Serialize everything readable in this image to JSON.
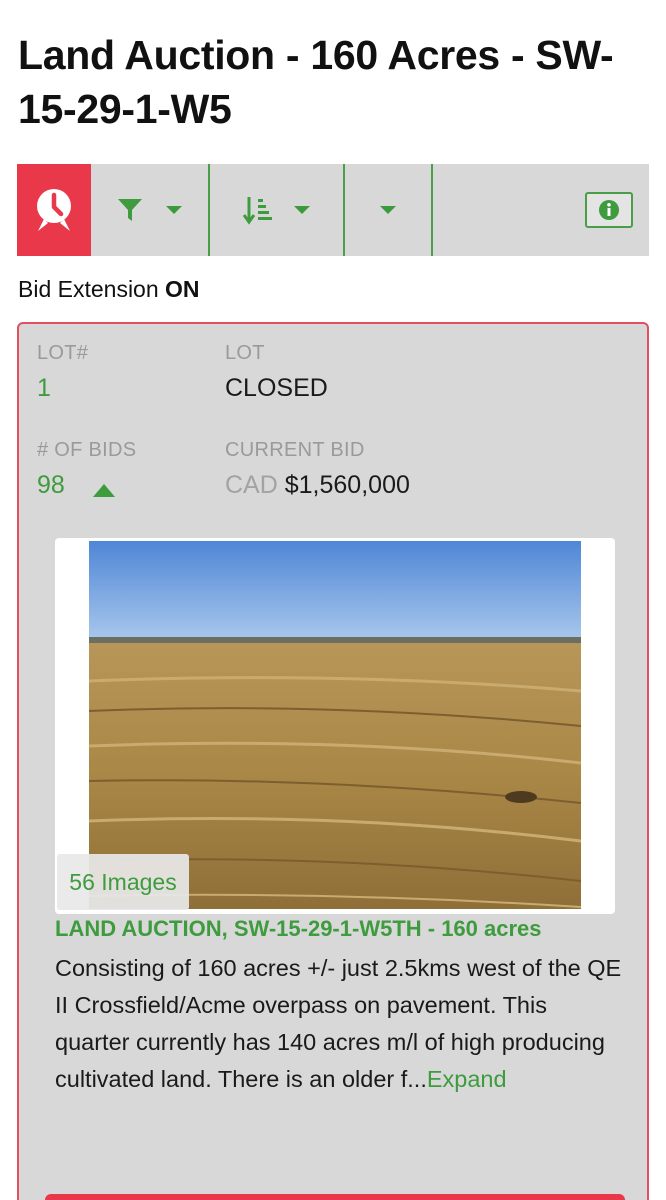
{
  "page": {
    "title": "Land Auction - 160 Acres - SW-15-29-1-W5"
  },
  "toolbar": {
    "icons": {
      "clock": "clock-icon",
      "filter": "filter-icon",
      "sort": "sort-icon",
      "info": "info-icon"
    },
    "colors": {
      "accent_red": "#e8384a",
      "accent_green": "#3e9b3e",
      "bar": "#d8d8d8"
    }
  },
  "bid_extension": {
    "label": "Bid Extension",
    "status": "ON"
  },
  "lot": {
    "lot_number_label": "LOT#",
    "lot_number": "1",
    "status_label": "LOT",
    "status": "CLOSED",
    "bids_label": "# OF BIDS",
    "bids_count": "98",
    "current_bid_label": "CURRENT BID",
    "currency": "CAD",
    "current_bid": "$1,560,000",
    "image_count": "56 Images",
    "title": "LAND AUCTION, SW-15-29-1-W5TH - 160 acres",
    "description": "Consisting of 160 acres +/- just 2.5kms west of the QE II Crossfield/Acme overpass on pavement. This quarter currently has 140 acres m/l of high producing cultivated land.  There is an older f...",
    "expand_label": "Expand"
  }
}
